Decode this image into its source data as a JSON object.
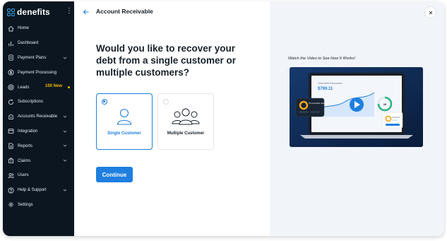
{
  "app": {
    "logo_text": "denefits"
  },
  "sidebar": {
    "items": [
      {
        "label": "Home",
        "icon": "home-icon",
        "chevron": false
      },
      {
        "label": "Dashboard",
        "icon": "bar-chart-icon",
        "chevron": false
      },
      {
        "label": "Payment Plans",
        "icon": "document-icon",
        "chevron": true
      },
      {
        "label": "Payment Processing",
        "icon": "dollar-circle-icon",
        "chevron": false
      },
      {
        "label": "Leads",
        "icon": "target-icon",
        "chevron": false,
        "badge": "100 New"
      },
      {
        "label": "Subscriptions",
        "icon": "refresh-dollar-icon",
        "chevron": false
      },
      {
        "label": "Accounts Receivable",
        "icon": "receivable-icon",
        "chevron": true
      },
      {
        "label": "Integration",
        "icon": "integration-icon",
        "chevron": true
      },
      {
        "label": "Reports",
        "icon": "report-icon",
        "chevron": true
      },
      {
        "label": "Claims",
        "icon": "claims-icon",
        "chevron": true
      },
      {
        "label": "Users",
        "icon": "users-icon",
        "chevron": false
      },
      {
        "label": "Help & Support",
        "icon": "help-icon",
        "chevron": true
      },
      {
        "label": "Settings",
        "icon": "gear-icon",
        "chevron": false
      }
    ],
    "colors": {
      "background": "#0b1620",
      "badge": "#f5b800"
    }
  },
  "main": {
    "title": "Account Receivable",
    "question": "Would you like to recover your debt from a single customer or multiple customers?",
    "options": [
      {
        "label": "Single Customer",
        "selected": true,
        "icon": "single-user-icon"
      },
      {
        "label": "Multiple Customer",
        "selected": false,
        "icon": "multiple-users-icon"
      }
    ],
    "continue_label": "Continue",
    "colors": {
      "accent": "#1e7fe0",
      "text": "#17212b"
    }
  },
  "video": {
    "caption": "Watch the Video to See How It Works!",
    "thumbnail": {
      "card_title": "Total Debt Recovered",
      "card_value": "$799.11",
      "popup_value": "70 recorded users",
      "ring_value": "26"
    }
  }
}
